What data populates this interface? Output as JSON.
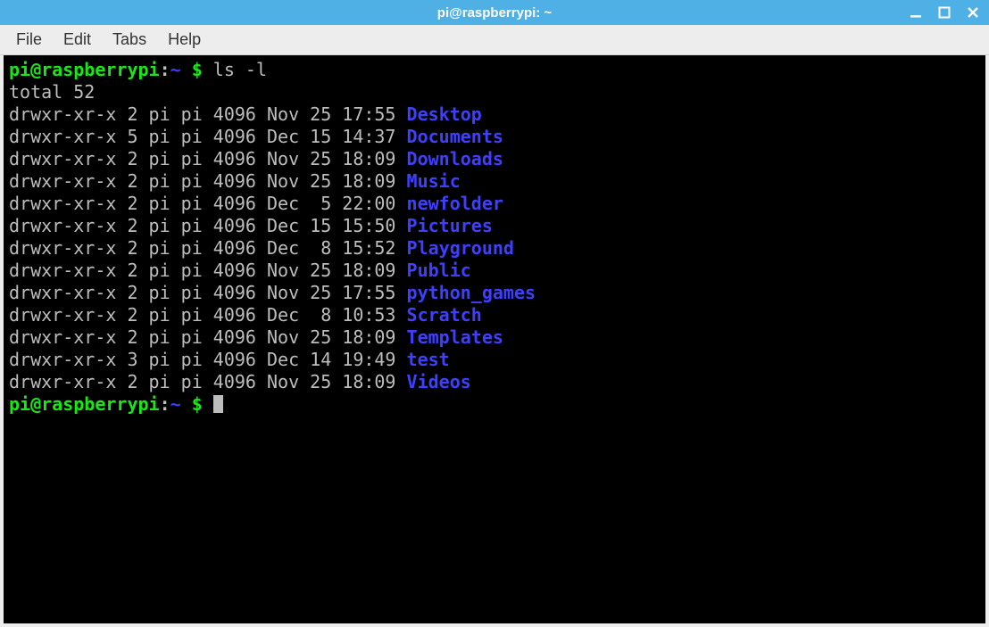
{
  "window": {
    "title": "pi@raspberrypi: ~"
  },
  "menubar": {
    "file": "File",
    "edit": "Edit",
    "tabs": "Tabs",
    "help": "Help"
  },
  "prompt": {
    "user_host": "pi@raspberrypi",
    "sep": ":",
    "path": "~",
    "dollar": " $ "
  },
  "command": "ls -l",
  "total_line": "total 52",
  "listing": [
    {
      "perms": "drwxr-xr-x",
      "links": "2",
      "owner": "pi",
      "group": "pi",
      "size": "4096",
      "month": "Nov",
      "day": "25",
      "time": "17:55",
      "name": "Desktop"
    },
    {
      "perms": "drwxr-xr-x",
      "links": "5",
      "owner": "pi",
      "group": "pi",
      "size": "4096",
      "month": "Dec",
      "day": "15",
      "time": "14:37",
      "name": "Documents"
    },
    {
      "perms": "drwxr-xr-x",
      "links": "2",
      "owner": "pi",
      "group": "pi",
      "size": "4096",
      "month": "Nov",
      "day": "25",
      "time": "18:09",
      "name": "Downloads"
    },
    {
      "perms": "drwxr-xr-x",
      "links": "2",
      "owner": "pi",
      "group": "pi",
      "size": "4096",
      "month": "Nov",
      "day": "25",
      "time": "18:09",
      "name": "Music"
    },
    {
      "perms": "drwxr-xr-x",
      "links": "2",
      "owner": "pi",
      "group": "pi",
      "size": "4096",
      "month": "Dec",
      "day": " 5",
      "time": "22:00",
      "name": "newfolder"
    },
    {
      "perms": "drwxr-xr-x",
      "links": "2",
      "owner": "pi",
      "group": "pi",
      "size": "4096",
      "month": "Dec",
      "day": "15",
      "time": "15:50",
      "name": "Pictures"
    },
    {
      "perms": "drwxr-xr-x",
      "links": "2",
      "owner": "pi",
      "group": "pi",
      "size": "4096",
      "month": "Dec",
      "day": " 8",
      "time": "15:52",
      "name": "Playground"
    },
    {
      "perms": "drwxr-xr-x",
      "links": "2",
      "owner": "pi",
      "group": "pi",
      "size": "4096",
      "month": "Nov",
      "day": "25",
      "time": "18:09",
      "name": "Public"
    },
    {
      "perms": "drwxr-xr-x",
      "links": "2",
      "owner": "pi",
      "group": "pi",
      "size": "4096",
      "month": "Nov",
      "day": "25",
      "time": "17:55",
      "name": "python_games"
    },
    {
      "perms": "drwxr-xr-x",
      "links": "2",
      "owner": "pi",
      "group": "pi",
      "size": "4096",
      "month": "Dec",
      "day": " 8",
      "time": "10:53",
      "name": "Scratch"
    },
    {
      "perms": "drwxr-xr-x",
      "links": "2",
      "owner": "pi",
      "group": "pi",
      "size": "4096",
      "month": "Nov",
      "day": "25",
      "time": "18:09",
      "name": "Templates"
    },
    {
      "perms": "drwxr-xr-x",
      "links": "3",
      "owner": "pi",
      "group": "pi",
      "size": "4096",
      "month": "Dec",
      "day": "14",
      "time": "19:49",
      "name": "test"
    },
    {
      "perms": "drwxr-xr-x",
      "links": "2",
      "owner": "pi",
      "group": "pi",
      "size": "4096",
      "month": "Nov",
      "day": "25",
      "time": "18:09",
      "name": "Videos"
    }
  ]
}
